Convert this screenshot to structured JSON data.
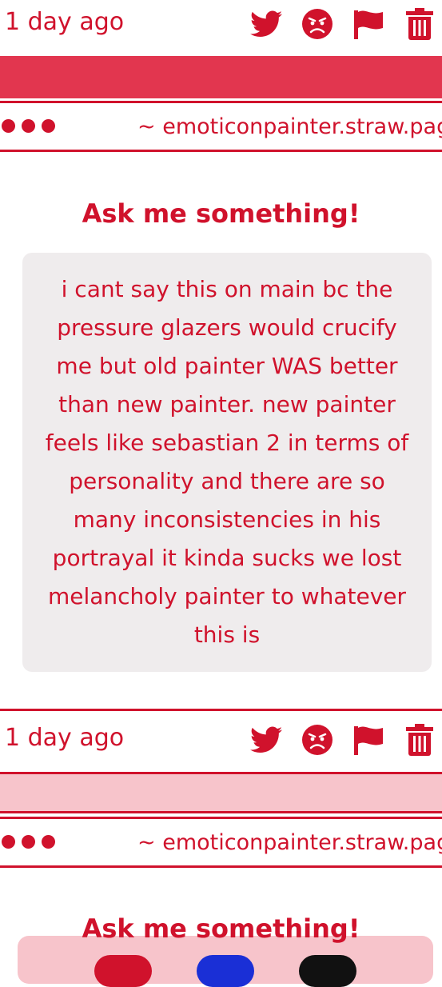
{
  "posts": [
    {
      "time": "1 day ago",
      "url": "~ emoticonpainter.straw.page",
      "heading": "Ask me something!",
      "question": "i cant say this on main bc the pressure glazers would crucify me but old painter WAS better than new painter. new painter feels like sebastian 2 in terms of personality and there are so many inconsistencies in his portrayal it kinda sucks we lost melancholy painter to whatever this is"
    },
    {
      "time": "1 day ago",
      "url": "~ emoticonpainter.straw.page",
      "heading": "Ask me something!"
    }
  ],
  "icons": [
    "twitter-icon",
    "angry-face-icon",
    "flag-icon",
    "trash-icon"
  ],
  "colors": {
    "accent": "#d0122c",
    "bar_solid": "#e2364f",
    "bar_light": "#f7c4cb",
    "question_bg": "#efeced"
  }
}
